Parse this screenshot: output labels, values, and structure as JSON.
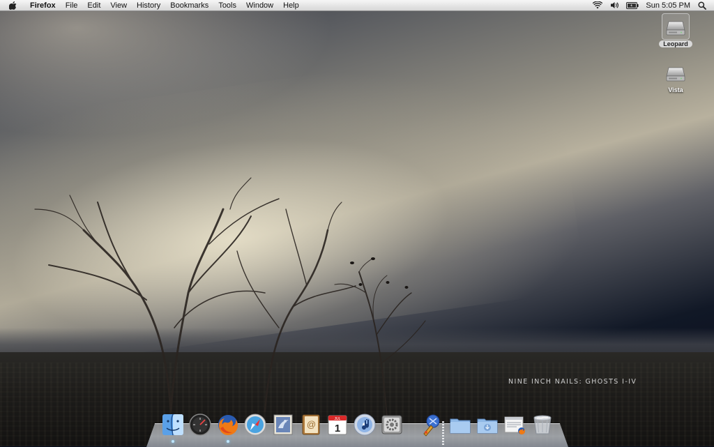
{
  "menubar": {
    "apple_icon": "apple-icon",
    "app_name": "Firefox",
    "menus": [
      "File",
      "Edit",
      "View",
      "History",
      "Bookmarks",
      "Tools",
      "Window",
      "Help"
    ],
    "status_icons": [
      "wifi-icon",
      "volume-icon",
      "battery-icon"
    ],
    "clock": "Sun 5:05 PM",
    "spotlight_icon": "spotlight-icon"
  },
  "desktop": {
    "drives": [
      {
        "label": "Leopard",
        "selected": true
      },
      {
        "label": "Vista",
        "selected": false
      }
    ],
    "wallpaper_caption": "NINE INCH NAILS: GHOSTS I-IV"
  },
  "dock": {
    "apps": [
      {
        "name": "Finder",
        "icon": "finder-icon",
        "running": true
      },
      {
        "name": "Dashboard",
        "icon": "dashboard-icon",
        "running": false
      },
      {
        "name": "Firefox",
        "icon": "firefox-icon",
        "running": true
      },
      {
        "name": "Safari",
        "icon": "safari-icon",
        "running": false
      },
      {
        "name": "Mail",
        "icon": "mail-icon",
        "running": false
      },
      {
        "name": "Address Book",
        "icon": "address-book-icon",
        "running": false
      },
      {
        "name": "iCal",
        "icon": "ical-icon",
        "running": false
      },
      {
        "name": "iTunes",
        "icon": "itunes-icon",
        "running": false
      },
      {
        "name": "System Preferences",
        "icon": "system-preferences-icon",
        "running": false
      }
    ],
    "others": [
      {
        "name": "Applications",
        "icon": "applications-folder-icon"
      },
      {
        "name": "Documents",
        "icon": "documents-folder-icon"
      },
      {
        "name": "Downloads",
        "icon": "downloads-folder-icon"
      },
      {
        "name": "Downloads Stack",
        "icon": "downloads-stack-icon"
      },
      {
        "name": "Trash",
        "icon": "trash-icon"
      }
    ],
    "ical_month": "JUL",
    "ical_day": "1"
  }
}
